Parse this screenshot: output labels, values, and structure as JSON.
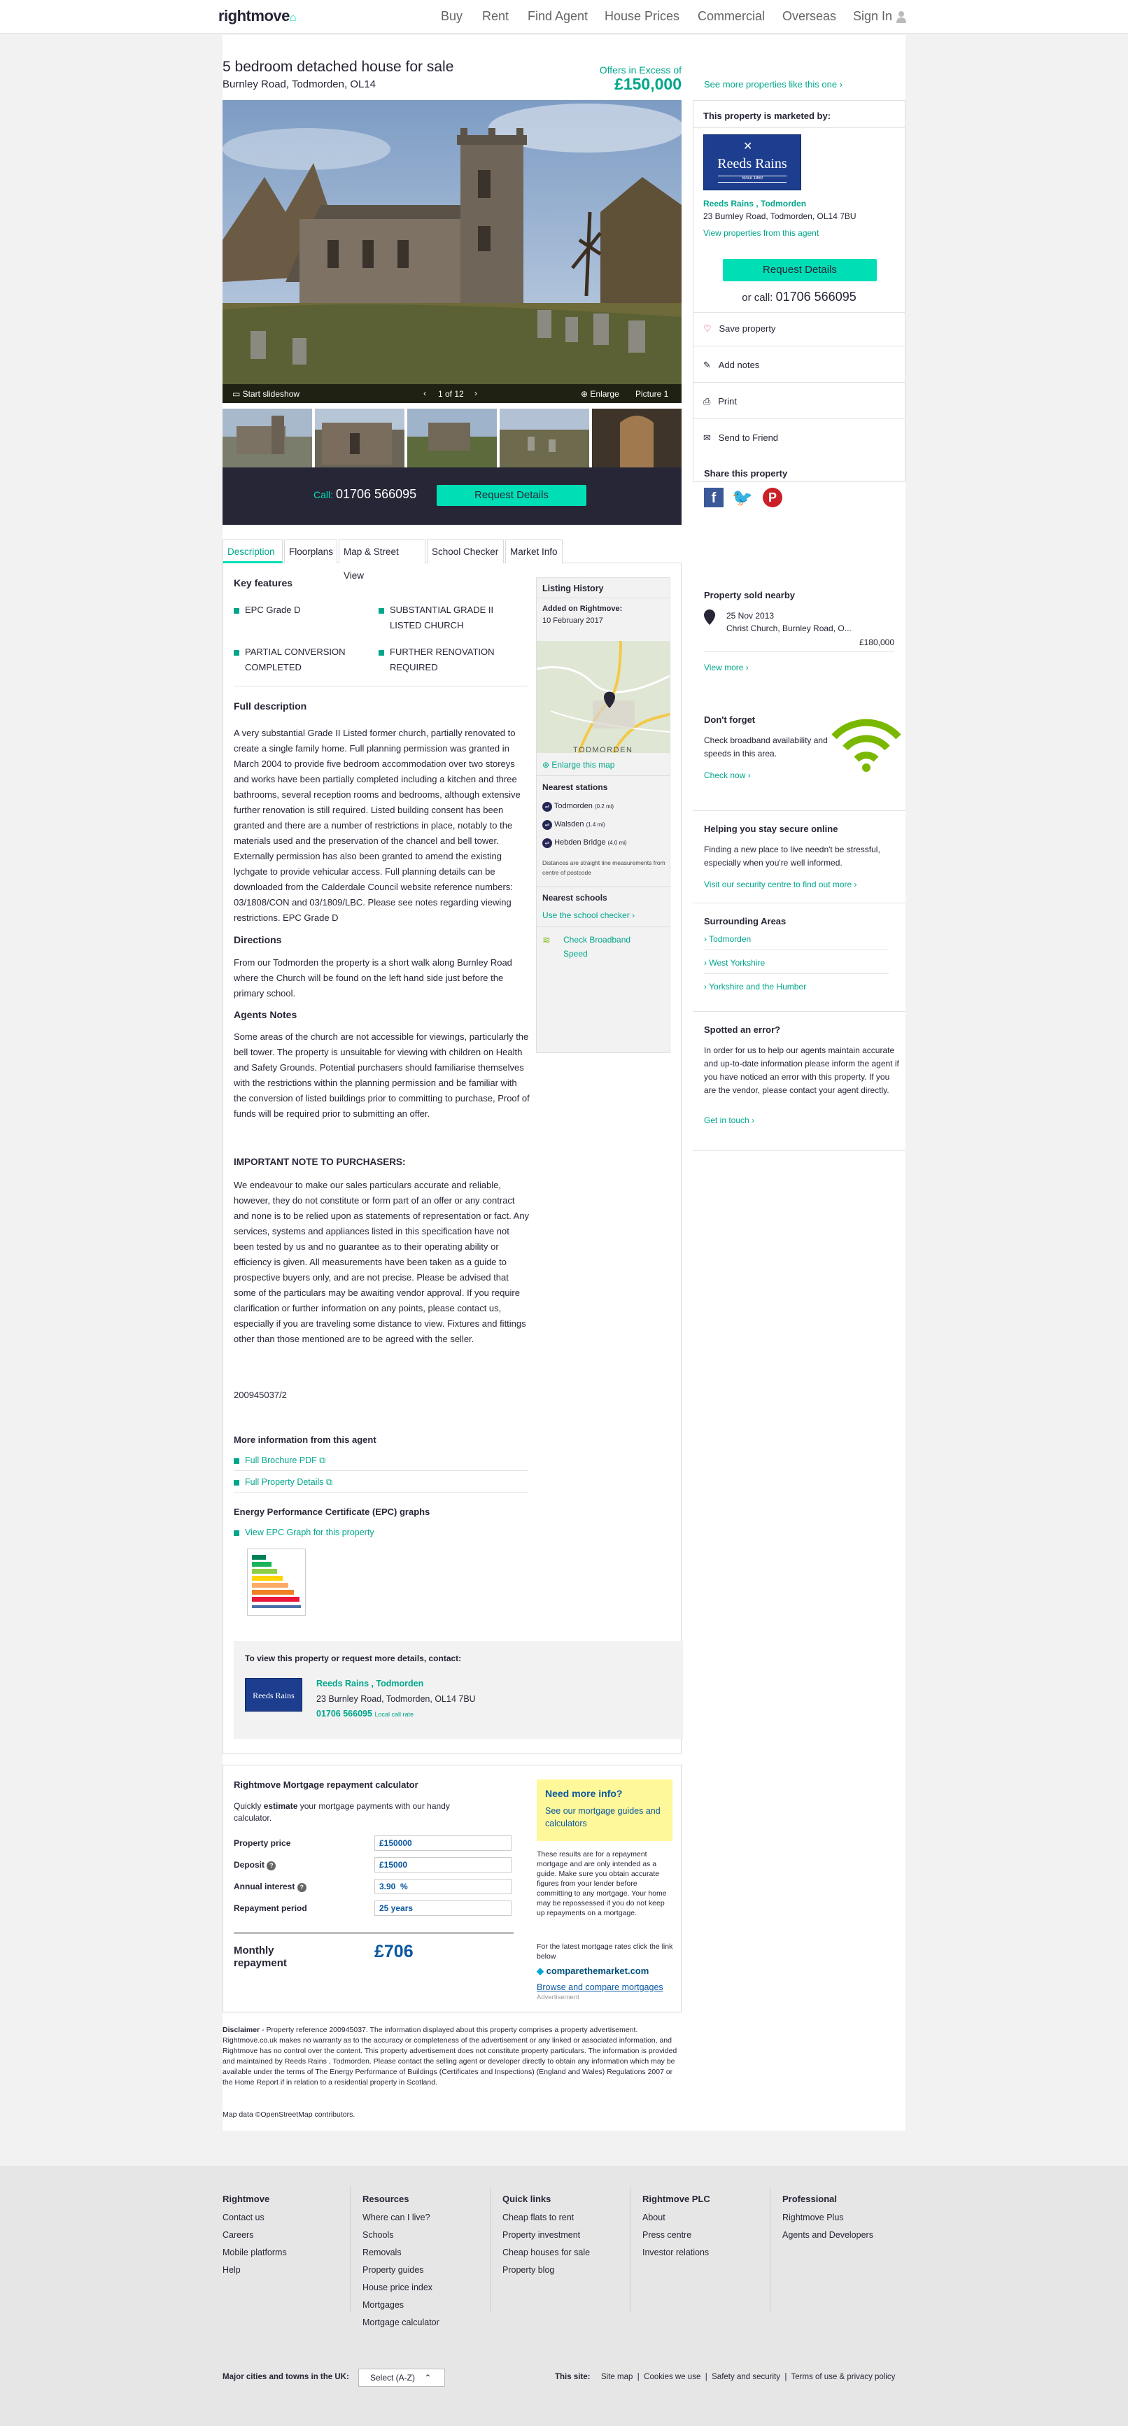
{
  "nav": {
    "logo": "rightmove",
    "items": [
      "Buy",
      "Rent",
      "Find Agent",
      "House Prices",
      "Commercial",
      "Overseas",
      "Sign In"
    ]
  },
  "listing": {
    "title": "5 bedroom detached house for sale",
    "address": "Burnley Road, Todmorden, OL14",
    "price_qualifier": "Offers in Excess of",
    "price": "£150,000",
    "see_more": "See more properties like this one",
    "gallery": {
      "slideshow": "Start slideshow",
      "counter": "1 of 12",
      "enlarge": "Enlarge",
      "picture": "Picture 1"
    },
    "call_label": "Call:",
    "phone": "01706 566095",
    "request_btn": "Request Details"
  },
  "agent_box": {
    "heading": "This property is marketed by:",
    "logo_text": "Reeds Rains",
    "logo_since": "Since 1869",
    "name": "Reeds Rains , Todmorden",
    "address": "23 Burnley Road, Todmorden, OL14 7BU",
    "view_link": "View properties from this agent",
    "request_btn": "Request Details",
    "or_call": "or call:",
    "phone": "01706 566095",
    "actions": [
      "Save property",
      "Add notes",
      "Print",
      "Send to Friend"
    ],
    "share_heading": "Share this property"
  },
  "tabs": [
    "Description",
    "Floorplans",
    "Map & Street View",
    "School Checker",
    "Market Info"
  ],
  "description": {
    "key_features_heading": "Key features",
    "features": [
      "EPC Grade D",
      "SUBSTANTIAL GRADE II LISTED CHURCH",
      "PARTIAL CONVERSION COMPLETED",
      "FURTHER RENOVATION REQUIRED"
    ],
    "full_desc_heading": "Full description",
    "full_desc": "A very substantial Grade II Listed former church, partially renovated to create a single family home. Full planning permission was granted in March 2004 to provide five bedroom accommodation over two storeys and works have been partially completed including a kitchen and three bathrooms, several reception rooms and bedrooms, although extensive further renovation is still required. Listed building consent has been granted and there are a number of restrictions in place, notably to the materials used and the preservation of the chancel and bell tower. Externally permission has also been granted to amend the existing lychgate to provide vehicular access. Full planning details can be downloaded from the Calderdale Council website reference numbers: 03/1808/CON and 03/1809/LBC. Please see notes regarding viewing restrictions. EPC Grade D",
    "directions_heading": "Directions",
    "directions": "From our Todmorden the property is a short walk along Burnley Road where the Church will be found on the left hand side just before the primary school.",
    "agents_notes_heading": "Agents Notes",
    "agents_notes": "Some areas of the church are not accessible for viewings, particularly the bell tower. The property is unsuitable for viewing with children on Health and Safety Grounds. Potential purchasers should familiarise themselves with the restrictions within the planning permission and be familiar with the conversion of listed buildings prior to committing to purchase, Proof of funds will be required prior to submitting an offer.",
    "important_heading": "IMPORTANT NOTE TO PURCHASERS:",
    "important": "We endeavour to make our sales particulars accurate and reliable, however, they do not constitute or form part of an offer or any contract and none is to be relied upon as statements of representation or fact. Any services, systems and appliances listed in this specification have not been tested by us and no guarantee as to their operating ability or efficiency is given. All measurements have been taken as a guide to prospective buyers only, and are not precise. Please be advised that some of the particulars may be awaiting vendor approval. If you require clarification or further information on any points, please contact us, especially if you are traveling some distance to view. Fixtures and fittings other than those mentioned are to be agreed with the seller.",
    "reference": "200945037/2",
    "more_info_heading": "More information from this agent",
    "brochure": "Full Brochure PDF",
    "property_details": "Full Property Details",
    "epc_heading": "Energy Performance Certificate (EPC) graphs",
    "epc_link": "View EPC Graph for this property",
    "contact_heading": "To view this property or request more details, contact:",
    "contact_name": "Reeds Rains , Todmorden",
    "contact_address": "23 Burnley Road, Todmorden, OL14 7BU",
    "contact_phone": "01706 566095",
    "contact_local": "Local call rate"
  },
  "listing_history": {
    "heading": "Listing History",
    "added_label": "Added on Rightmove:",
    "added_date": "10 February 2017",
    "map_label": "TODMORDEN",
    "enlarge_map": "Enlarge this map",
    "stations_heading": "Nearest stations",
    "stations": [
      {
        "name": "Todmorden",
        "dist": "(0.2 mi)"
      },
      {
        "name": "Walsden",
        "dist": "(1.4 mi)"
      },
      {
        "name": "Hebden Bridge",
        "dist": "(4.0 mi)"
      }
    ],
    "distance_note": "Distances are straight line measurements from centre of postcode",
    "schools_heading": "Nearest schools",
    "school_link": "Use the school checker",
    "broadband": "Check Broadband Speed"
  },
  "right_widgets": {
    "sold_heading": "Property sold nearby",
    "sold_date": "25 Nov 2013",
    "sold_address": "Christ Church, Burnley Road, O...",
    "sold_price": "£180,000",
    "view_more": "View more",
    "dont_forget_heading": "Don't forget",
    "dont_forget_text": "Check broadband availability and speeds in this area.",
    "check_now": "Check now",
    "safe_heading": "Helping you stay secure online",
    "safe_text": "Finding a new place to live needn't be stressful, especially when you're well informed.",
    "safe_link": "Visit our security centre to find out more",
    "surrounding_heading": "Surrounding Areas",
    "surrounding": [
      "Todmorden",
      "West Yorkshire",
      "Yorkshire and the Humber"
    ],
    "error_heading": "Spotted an error?",
    "error_text": "In order for us to help our agents maintain accurate and up-to-date information please inform the agent if you have noticed an error with this property. If you are the vendor, please contact your agent directly.",
    "get_in_touch": "Get in touch"
  },
  "mortgage": {
    "heading": "Rightmove Mortgage repayment calculator",
    "intro_a": "Quickly ",
    "intro_b": "estimate",
    "intro_c": " your mortgage payments with our handy calculator.",
    "fields": [
      {
        "label": "Property price",
        "value": "£150000"
      },
      {
        "label": "Deposit",
        "value": "£15000"
      },
      {
        "label": "Annual interest",
        "value": "3.90  %"
      },
      {
        "label": "Repayment period",
        "value": "25 years"
      }
    ],
    "monthly_label": "Monthly repayment",
    "monthly_value": "£706",
    "need_info": "Need more info?",
    "guides": "See our mortgage guides and calculators",
    "disclaimer": "These results are for a repayment mortgage and are only intended as a guide. Make sure you obtain accurate figures from your lender before committing to any mortgage. Your home may be repossessed if you do not keep up repayments on a mortgage.",
    "latest": "For the latest mortgage rates click the link below",
    "ctm": "comparethemarket.com",
    "browse": "Browse and compare mortgages",
    "advert": "Advertisement"
  },
  "disclaimer": {
    "label": "Disclaimer",
    "text": " - Property reference 200945037. The information displayed about this property comprises a property advertisement. Rightmove.co.uk makes no warranty as to the accuracy or completeness of the advertisement or any linked or associated information, and Rightmove has no control over the content. This property advertisement does not constitute property particulars. The information is provided and maintained by Reeds Rains , Todmorden. Please contact the selling agent or developer directly to obtain any information which may be available under the terms of The Energy Performance of Buildings (Certificates and Inspections) (England and Wales) Regulations 2007 or the Home Report if in relation to a residential property in Scotland.",
    "map_data": "Map data ©OpenStreetMap contributors."
  },
  "footer": {
    "columns": [
      {
        "heading": "Rightmove",
        "items": [
          "Contact us",
          "Careers",
          "Mobile platforms",
          "Help"
        ]
      },
      {
        "heading": "Resources",
        "items": [
          "Where can I live?",
          "Schools",
          "Removals",
          "Property guides",
          "House price index",
          "Mortgages",
          "Mortgage calculator"
        ]
      },
      {
        "heading": "Quick links",
        "items": [
          "Cheap flats to rent",
          "Property investment",
          "Cheap houses for sale",
          "Property blog"
        ]
      },
      {
        "heading": "Rightmove PLC",
        "items": [
          "About",
          "Press centre",
          "Investor relations"
        ]
      },
      {
        "heading": "Professional",
        "items": [
          "Rightmove Plus",
          "Agents and Developers"
        ]
      }
    ],
    "cities_label": "Major cities and towns in the UK:",
    "cities_select": "Select (A-Z)",
    "this_site": "This site:",
    "site_links": [
      "Site map",
      "Cookies we use",
      "Safety and security",
      "Terms of use & privacy policy"
    ]
  }
}
